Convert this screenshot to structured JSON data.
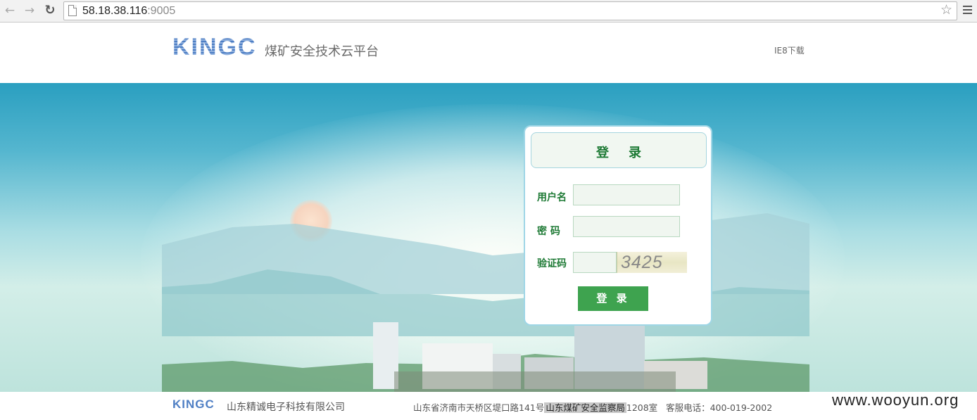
{
  "browser": {
    "url_host": "58.18.38.116",
    "url_port": ":9005"
  },
  "header": {
    "logo_text": "KINGC",
    "site_title": "煤矿安全技术云平台",
    "ie_link": "IE8下载"
  },
  "login": {
    "title": "登录",
    "username_label": "用户名",
    "password_label": "密 码",
    "captcha_label": "验证码",
    "captcha_value": "3425",
    "username_value": "",
    "password_value": "",
    "captcha_input_value": "",
    "submit_label": "登 录"
  },
  "footer": {
    "logo_text": "KINGC",
    "company": "山东精诚电子科技有限公司",
    "address_prefix": "山东省济南市天桥区堤口路141号",
    "address_highlight": "山东煤矿安全监察局",
    "address_suffix": "1208室",
    "service_phone": "客服电话：400-019-2002"
  },
  "watermark": "www.wooyun.org",
  "colors": {
    "brand_blue": "#4f7fc4",
    "login_green": "#1e7a35",
    "button_green": "#3ea34f"
  }
}
